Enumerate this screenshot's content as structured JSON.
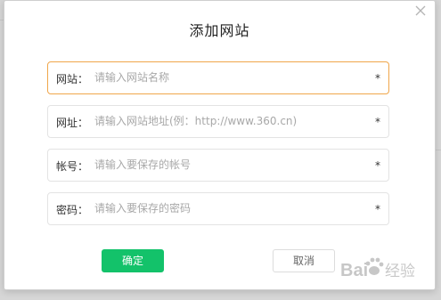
{
  "dialog": {
    "title": "添加网站",
    "close_icon": "close-icon"
  },
  "fields": [
    {
      "label": "网站：",
      "placeholder": "请输入网站名称",
      "required_mark": "*",
      "value": ""
    },
    {
      "label": "网址：",
      "placeholder": "请输入网站地址(例：http://www.360.cn)",
      "required_mark": "*",
      "value": ""
    },
    {
      "label": "帐号：",
      "placeholder": "请输入要保存的帐号",
      "required_mark": "*",
      "value": ""
    },
    {
      "label": "密码：",
      "placeholder": "请输入要保存的密码",
      "required_mark": "*",
      "value": ""
    }
  ],
  "buttons": {
    "confirm_label": "确定",
    "cancel_label": "取消"
  },
  "colors": {
    "confirm_bg": "#13c26a",
    "focused_border": "#f0a64a"
  },
  "watermark": {
    "icon": "baidu-paw-icon",
    "text": "Bai经验"
  }
}
